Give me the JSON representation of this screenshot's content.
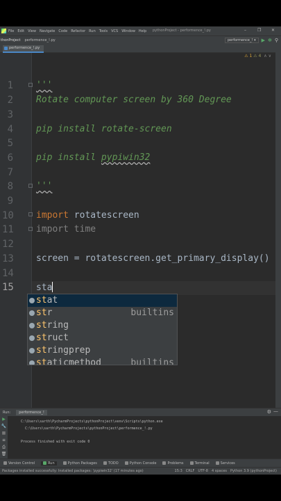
{
  "menubar": {
    "items": [
      "File",
      "Edit",
      "View",
      "Navigate",
      "Code",
      "Refactor",
      "Run",
      "Tools",
      "VCS",
      "Window",
      "Help"
    ],
    "window_title": "pythonProject - performence_!.py",
    "minimize": "–",
    "maximize": "❐",
    "close": "✕"
  },
  "navbar": {
    "project": "thonProject",
    "file": "performence_!.py",
    "run_config": "performence_!",
    "run_config_arrow": "▾",
    "run_icon": "▶",
    "debug_icon": "✻",
    "search_icon": "⚲"
  },
  "tab": {
    "label": "performence_!.py"
  },
  "inspections": {
    "warnings": "⚠ 1",
    "weak": "⚠ 4",
    "arrows": "∧ ∨"
  },
  "editor": {
    "line_numbers": [
      "1",
      "2",
      "3",
      "4",
      "5",
      "6",
      "7",
      "8",
      "9",
      "10",
      "11",
      "12",
      "13",
      "14",
      "15"
    ],
    "active_line": "15",
    "lines": {
      "l1": "'''",
      "l2": "Rotate computer screen by 360 Degree",
      "l4": "pip install rotate-screen",
      "l6_pre": "pip install ",
      "l6_squig": "pypiwin32",
      "l8": "'''",
      "l10_kw": "import",
      "l10_rest": " rotatescreen",
      "l11": "import time",
      "l13": "screen = rotatescreen.get_primary_display()",
      "l15": "sta"
    }
  },
  "autocomplete": {
    "items": [
      {
        "match": "st",
        "rest": "at",
        "source": ""
      },
      {
        "match": "st",
        "rest": "r",
        "source": "builtins"
      },
      {
        "match": "st",
        "rest": "ring",
        "source": ""
      },
      {
        "match": "st",
        "rest": "ruct",
        "source": ""
      },
      {
        "match": "st",
        "rest": "ringprep",
        "source": ""
      },
      {
        "match": "st",
        "rest": "aticmethod",
        "source": "builtins"
      }
    ]
  },
  "run_panel": {
    "label": "Run:",
    "tab": "performence_!",
    "gear": "⚙",
    "minimize": "—",
    "side_icons": [
      "▶",
      "🔧",
      "■",
      "≡",
      "⎙",
      "🗑"
    ],
    "console": [
      "C:\\Users\\sarth\\PycharmProjects\\pythonProject\\venv\\Scripts\\python.exe",
      "  C:\\Users\\sarth\\PycharmProjects\\pythonProject\\performence_!.py",
      "",
      "Process finished with exit code 0"
    ]
  },
  "tool_tabs": [
    "Version Control",
    "Run",
    "Python Packages",
    "TODO",
    "Python Console",
    "Problems",
    "Terminal",
    "Services"
  ],
  "status": {
    "message": "Packages installed successfully: Installed packages: 'pypiwin32' (17 minutes ago)",
    "position": "15:3",
    "line_sep": "CRLF",
    "encoding": "UTF-8",
    "indent": "4 spaces",
    "interpreter": "Python 3.9 (pythonProject)"
  },
  "colors": {
    "accent": "#4a88c7",
    "comment": "#629755",
    "keyword": "#cc7832",
    "match": "#ffc66d"
  }
}
